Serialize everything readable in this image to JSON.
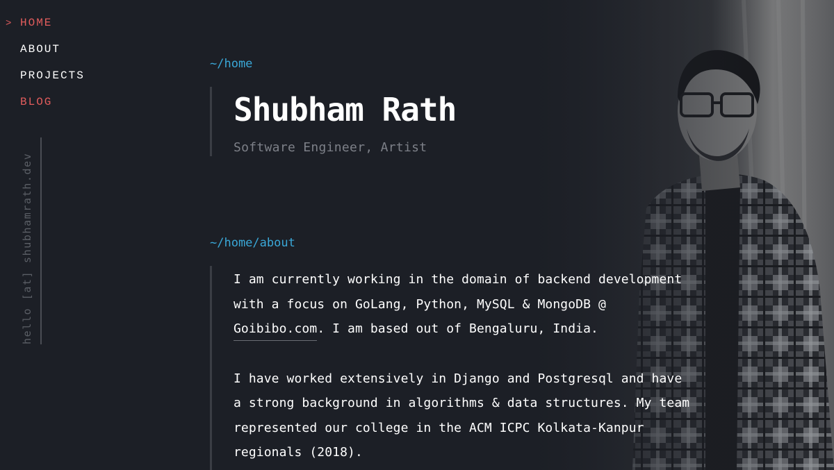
{
  "nav": {
    "caret": ">",
    "items": [
      {
        "label": "HOME"
      },
      {
        "label": "ABOUT"
      },
      {
        "label": "PROJECTS"
      },
      {
        "label": "BLOG"
      }
    ]
  },
  "email": "hello [at] shubhamrath.dev",
  "home": {
    "path": "~/home",
    "name": "Shubham Rath",
    "subtitle": "Software Engineer, Artist"
  },
  "about": {
    "path": "~/home/about",
    "p1": {
      "line1": "I am currently working in the domain of backend development",
      "line2": "with a focus on GoLang, Python, MySQL & MongoDB @",
      "link": "Goibibo.com",
      "line3_rest": ". I am based out of Bengaluru, India."
    },
    "p2": {
      "line1": "I have worked extensively in Django and Postgresql and have",
      "line2": "a strong background in algorithms & data structures. My team",
      "line3": "represented our college in the ACM ICPC Kolkata-Kanpur",
      "line4": "regionals (2018)."
    }
  },
  "colors": {
    "background": "#1c1f26",
    "accent": "#e35d5d",
    "path": "#3aa8d8",
    "muted": "#7d8088"
  }
}
